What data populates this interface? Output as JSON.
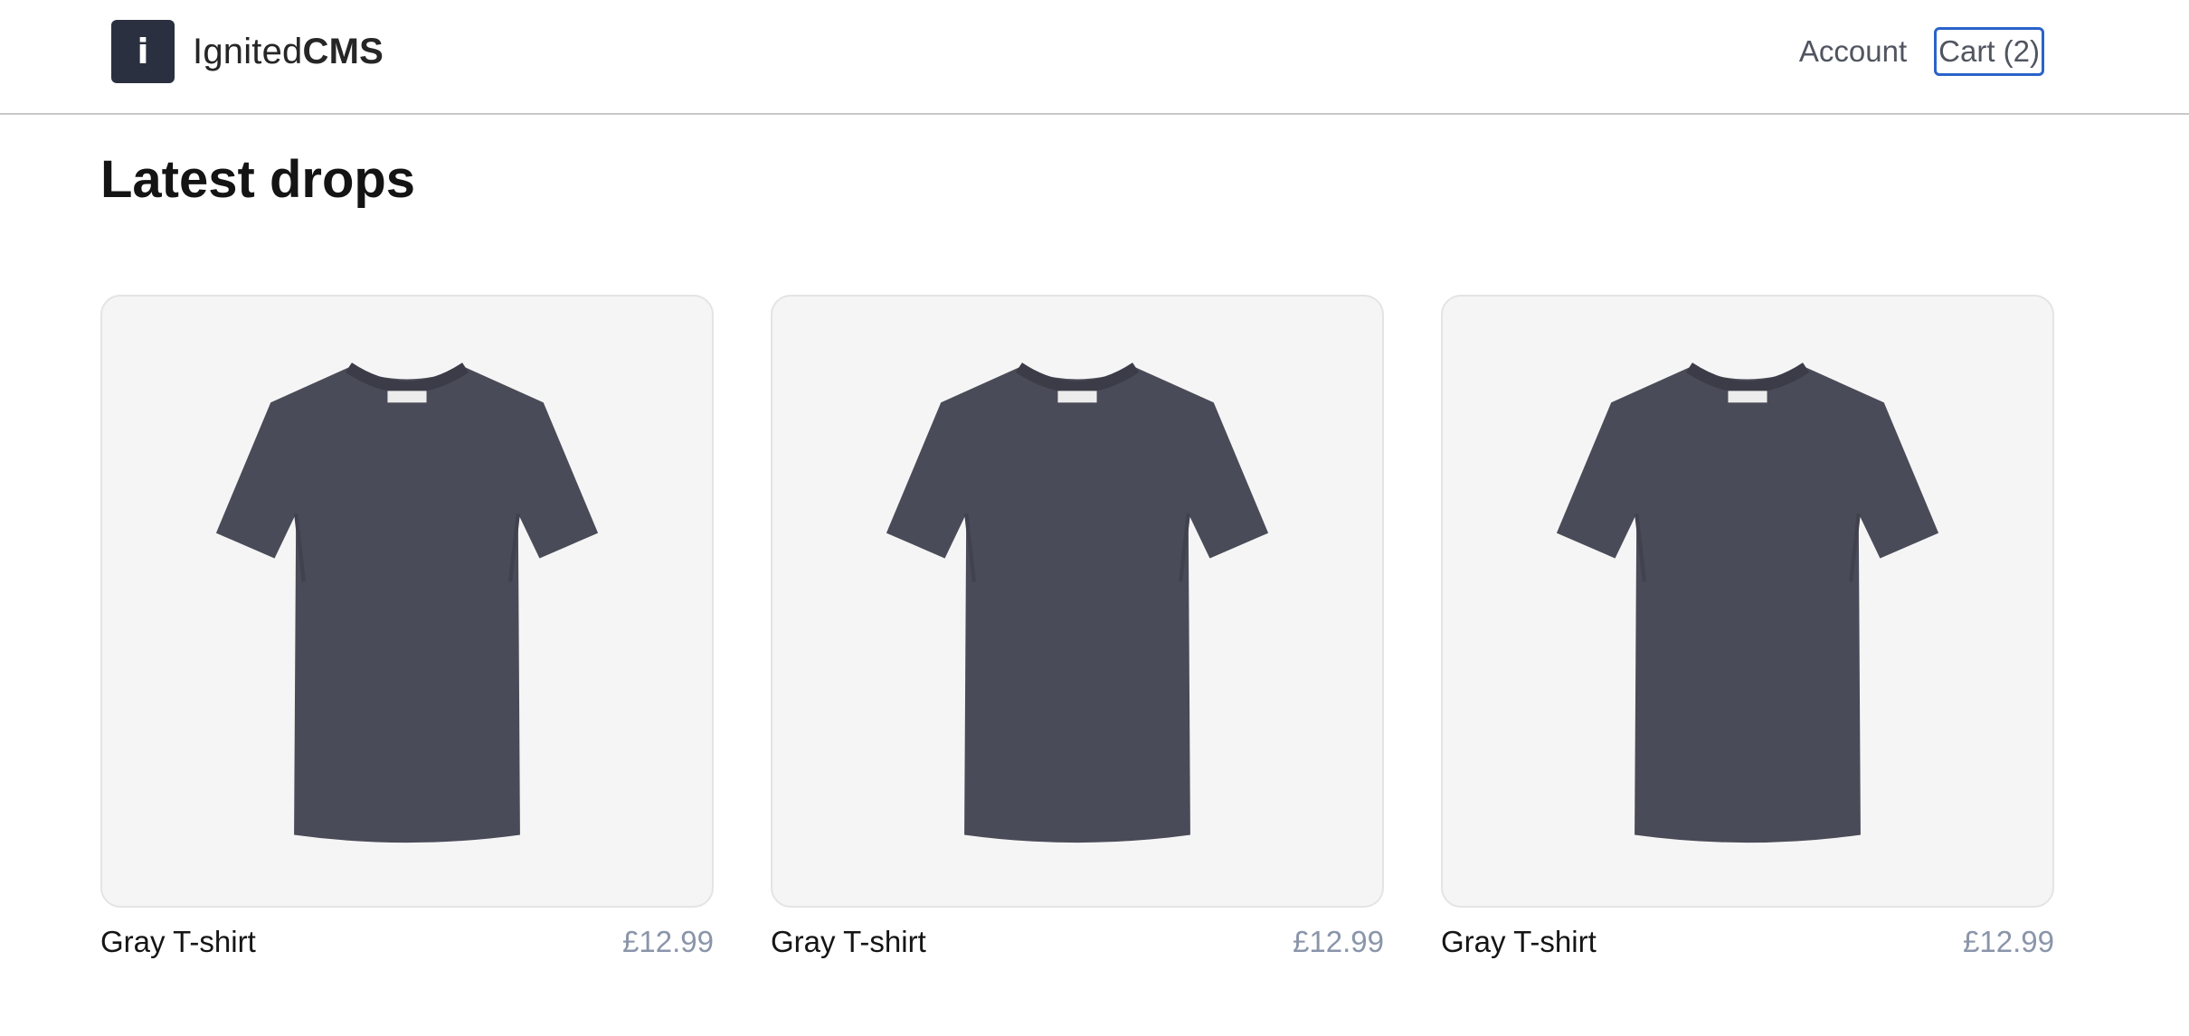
{
  "header": {
    "logo_letter": "i",
    "brand_light": "Ignited",
    "brand_bold": "CMS",
    "nav": {
      "account": "Account",
      "cart": "Cart (2)"
    }
  },
  "main": {
    "title": "Latest drops",
    "products": [
      {
        "name": "Gray T-shirt",
        "price": "£12.99",
        "image_icon": "tshirt-icon"
      },
      {
        "name": "Gray T-shirt",
        "price": "£12.99",
        "image_icon": "tshirt-icon"
      },
      {
        "name": "Gray T-shirt",
        "price": "£12.99",
        "image_icon": "tshirt-icon"
      }
    ]
  },
  "colors": {
    "logo_bg": "#2a3040",
    "focus_ring": "#2a63c9",
    "shirt": "#4a4b58",
    "price": "#8a95aa"
  }
}
